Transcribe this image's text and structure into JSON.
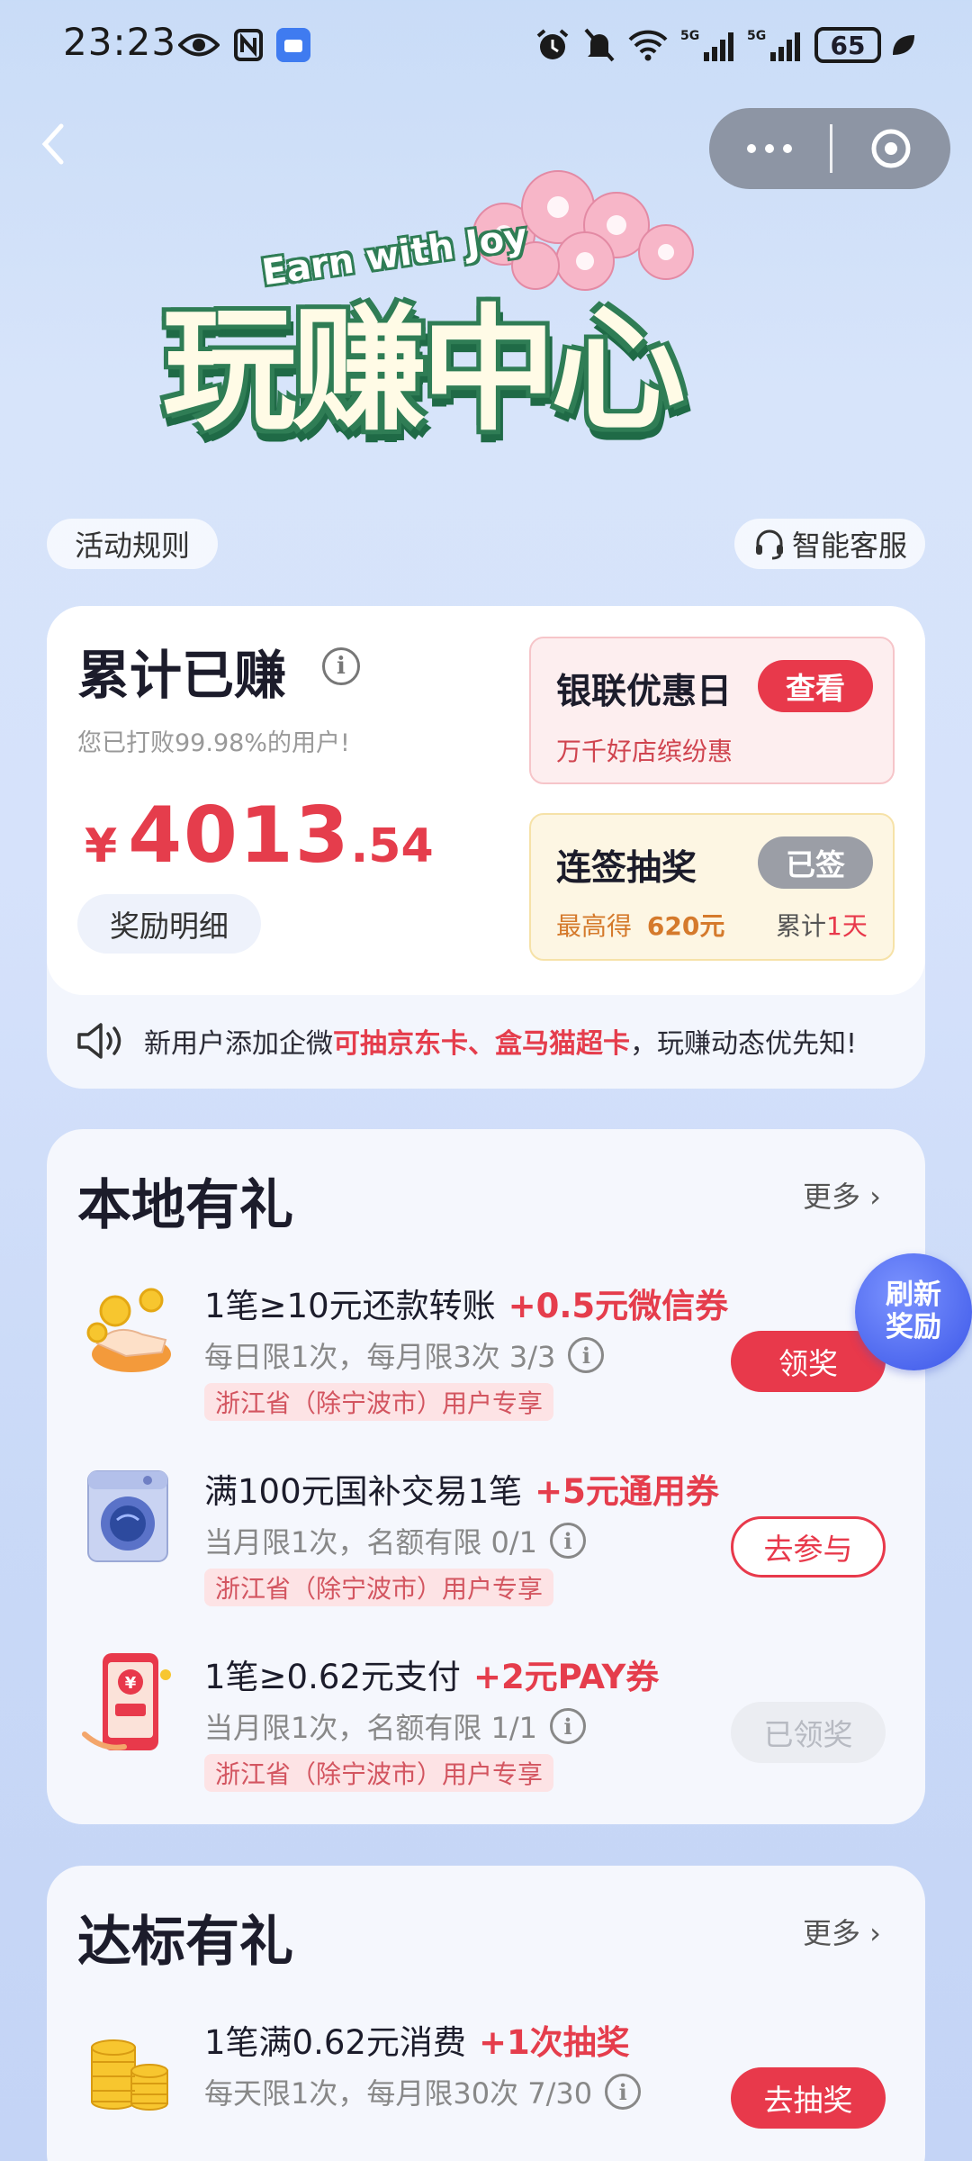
{
  "status_bar": {
    "time": "23:23",
    "battery": "65",
    "icons": [
      "eye-icon",
      "nfc-icon",
      "app-icon",
      "alarm-icon",
      "mute-icon",
      "wifi-icon",
      "signal-5g-icon",
      "signal-5g-icon",
      "leaf-icon"
    ]
  },
  "nav": {
    "back_icon": "chevron-left-icon",
    "more_icon": "ellipsis-icon",
    "close_icon": "close-circle-icon"
  },
  "banner": {
    "title": "玩赚中心",
    "subtitle": "Earn with Joy"
  },
  "rules_label": "活动规则",
  "service_label": "智能客服",
  "earnings": {
    "title": "累计已赚",
    "subtitle": "您已打败99.98%的用户!",
    "currency": "¥",
    "amount_int": "4013",
    "amount_dec": ".54",
    "detail_label": "奖励明细"
  },
  "unionpay_card": {
    "title": "银联优惠日",
    "button": "查看",
    "desc": "万千好店缤纷惠"
  },
  "checkin_card": {
    "title": "连签抽奖",
    "button": "已签",
    "desc_prefix": "最高得",
    "desc_amount": "620元",
    "streak_prefix": "累计",
    "streak_value": "1天"
  },
  "notice": {
    "prefix": "新用户添加企微",
    "highlight": "可抽京东卡、盒马猫超卡",
    "suffix": "，玩赚动态优先知!"
  },
  "local_section": {
    "title": "本地有礼",
    "more": "更多 ›",
    "refresh_label": [
      "刷新",
      "奖励"
    ],
    "tasks": [
      {
        "title": "1笔≥10元还款转账",
        "reward": "+0.5元微信券",
        "limit": "每日限1次，每月限3次 3/3",
        "tag": "浙江省（除宁波市）用户专享",
        "button": "领奖",
        "button_style": "red",
        "icon": "hand-coins-icon"
      },
      {
        "title": "满100元国补交易1笔",
        "reward": "+5元通用券",
        "limit": "当月限1次，名额有限 0/1",
        "tag": "浙江省（除宁波市）用户专享",
        "button": "去参与",
        "button_style": "outline",
        "icon": "washing-machine-icon"
      },
      {
        "title": "1笔≥0.62元支付",
        "reward": "+2元PAY券",
        "limit": "当月限1次，名额有限 1/1",
        "tag": "浙江省（除宁波市）用户专享",
        "button": "已领奖",
        "button_style": "gray",
        "icon": "phone-pay-icon"
      }
    ]
  },
  "target_section": {
    "title": "达标有礼",
    "more": "更多 ›",
    "tasks": [
      {
        "title": "1笔满0.62元消费",
        "reward": "+1次抽奖",
        "limit": "每天限1次，每月限30次 7/30",
        "button": "去抽奖",
        "button_style": "red",
        "icon": "coin-stack-icon"
      }
    ]
  },
  "colors": {
    "accent_red": "#e8394b",
    "amount_red": "#e53d4c",
    "brand_green": "#2f7d55",
    "refresh_blue": "#3b56e8"
  }
}
